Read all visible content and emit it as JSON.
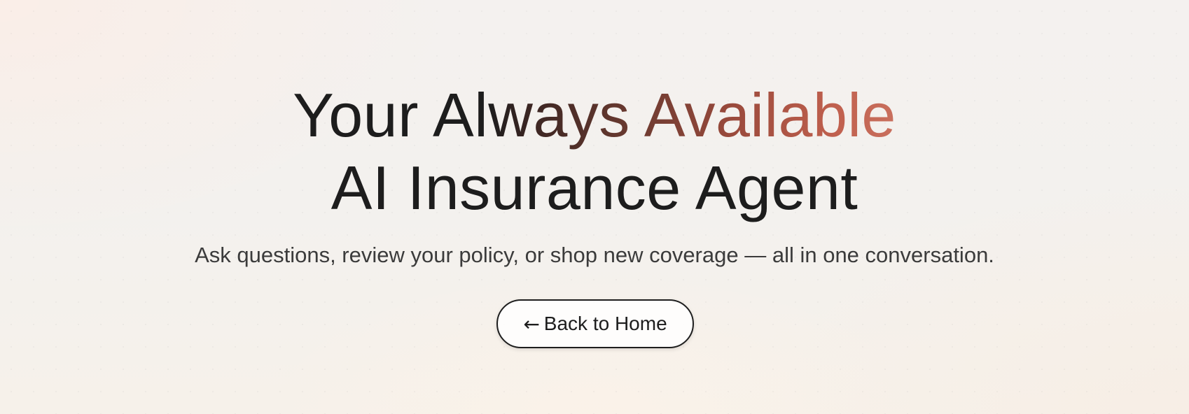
{
  "hero": {
    "headline_line1_plain": "Your Al",
    "headline_line1_gradient": "ways Available",
    "headline_line2": "AI Insurance Agent",
    "subtitle": "Ask questions, review your policy, or shop new coverage — all in one conversation."
  },
  "back_button": {
    "arrow_icon": "←",
    "label": "Back to Home"
  },
  "colors": {
    "text": "#1d1d1d",
    "accent_start": "#6a3a30",
    "accent_end": "#c9705e"
  }
}
